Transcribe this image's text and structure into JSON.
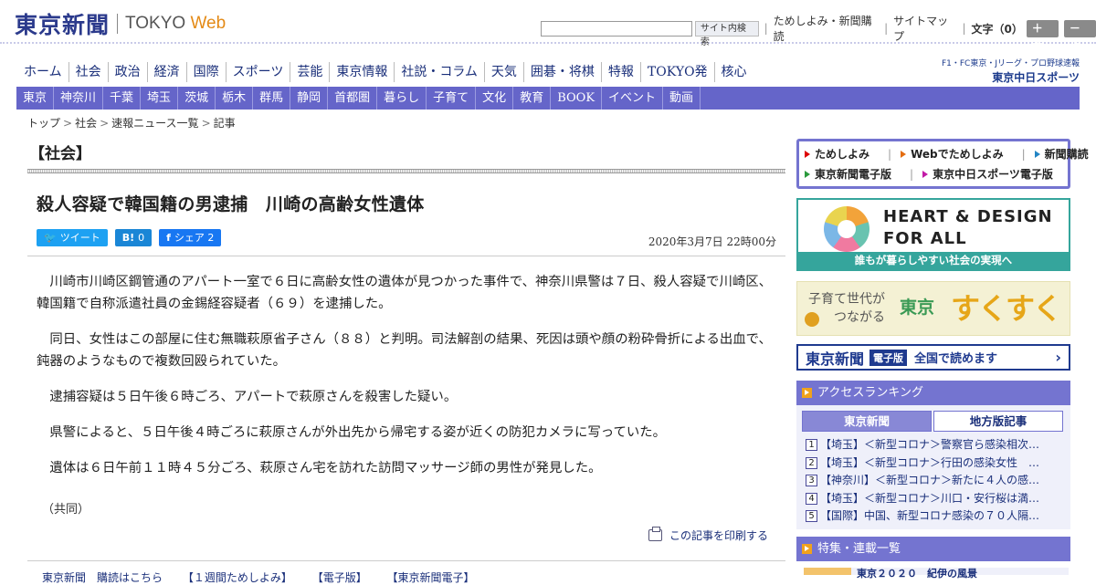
{
  "header": {
    "logo_jp": "東京新聞",
    "logo_en": "TOKYO",
    "logo_web": "Web",
    "search_placeholder": "",
    "search_button": "サイト内検索",
    "links": [
      "ためしよみ・新聞購読",
      "サイトマップ"
    ],
    "font_size_label": "文字（0）",
    "bigger": "＋大",
    "smaller": "－小"
  },
  "global_nav": [
    "ホーム",
    "社会",
    "政治",
    "経済",
    "国際",
    "スポーツ",
    "芸能",
    "東京情報",
    "社説・コラム",
    "天気",
    "囲碁・将棋",
    "特報",
    "TOKYO発",
    "核心"
  ],
  "sports_logo": {
    "line1": "F1・FC東京・Jリーグ・プロ野球速報",
    "line2": "東京中日スポーツ"
  },
  "local_nav": [
    "東京",
    "神奈川",
    "千葉",
    "埼玉",
    "茨城",
    "栃木",
    "群馬",
    "静岡",
    "首都圏",
    "暮らし",
    "子育て",
    "文化",
    "教育",
    "BOOK",
    "イベント",
    "動画"
  ],
  "breadcrumb": [
    "トップ",
    "社会",
    "速報ニュース一覧",
    "記事"
  ],
  "category": "【社会】",
  "article": {
    "title": "殺人容疑で韓国籍の男逮捕　川崎の高齢女性遺体",
    "date": "2020年3月7日 22時00分",
    "share": {
      "tweet": "ツイート",
      "hatena_icon": "B!",
      "hatena_count": "0",
      "fb_label": "シェア",
      "fb_count": "2"
    },
    "paragraphs": [
      "川崎市川崎区鋼管通のアパート一室で６日に高齢女性の遺体が見つかった事件で、神奈川県警は７日、殺人容疑で川崎区、韓国籍で自称派遣社員の金錫経容疑者（６９）を逮捕した。",
      "同日、女性はこの部屋に住む無職萩原省子さん（８８）と判明。司法解剖の結果、死因は頭や顔の粉砕骨折による出血で、鈍器のようなもので複数回殴られていた。",
      "逮捕容疑は５日午後６時ごろ、アパートで萩原さんを殺害した疑い。",
      "県警によると、５日午後４時ごろに萩原さんが外出先から帰宅する姿が近くの防犯カメラに写っていた。",
      "遺体は６日午前１１時４５分ごろ、萩原さん宅を訪れた訪問マッサージ師の男性が発見した。"
    ],
    "source": "（共同）",
    "print_label": "この記事を印刷する"
  },
  "bottom_links": [
    "東京新聞　購読はこちら",
    "【１週間ためしよみ】",
    "【電子版】",
    "【東京新聞電子】"
  ],
  "right": {
    "links_row1": [
      "ためしよみ",
      "Webでためしよみ",
      "新聞購読"
    ],
    "links_row2": [
      "東京新聞電子版",
      "東京中日スポーツ電子版"
    ],
    "hd_line1": "HEART & DESIGN",
    "hd_line2": "FOR ALL",
    "hd_footer": "誰もが暮らしやすい社会の実現へ",
    "sk_line1": "子育て世代が",
    "sk_line2": "つながる",
    "sk_brand1": "東京",
    "sk_brand2": "すくすく",
    "ep_logo": "東京新聞",
    "ep_badge": "電子版",
    "ep_text": "全国で読めます",
    "ep_arrow": "›",
    "ranking_title": "アクセスランキング",
    "ranking_tabs": [
      "東京新聞",
      "地方版記事"
    ],
    "ranking": [
      "【埼玉】＜新型コロナ＞警察官ら感染相次…",
      "【埼玉】＜新型コロナ＞行田の感染女性　…",
      "【神奈川】＜新型コロナ＞新たに４人の感…",
      "【埼玉】＜新型コロナ＞川口・安行桜は満…",
      "【国際】中国、新型コロナ感染の７０人隔…"
    ],
    "feature_title": "特集・連載一覧",
    "feature_item": "東京２０２０　紀伊の風景"
  }
}
